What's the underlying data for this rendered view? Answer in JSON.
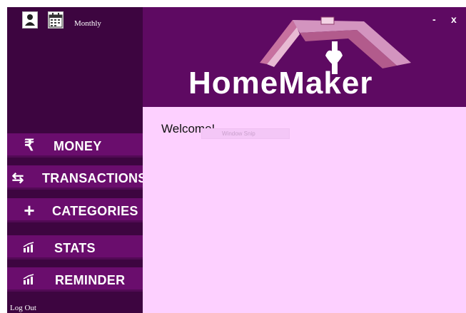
{
  "header": {
    "period": "Monthly",
    "brand": "HomeMaker",
    "minimize": "-",
    "close": "x"
  },
  "nav": [
    {
      "label": "MONEY",
      "icon": "rupee-icon",
      "glyph": "₹"
    },
    {
      "label": "TRANSACTIONS",
      "icon": "swap-arrows-icon",
      "glyph": "⇆"
    },
    {
      "label": "CATEGORIES",
      "icon": "plus-icon",
      "glyph": "+"
    },
    {
      "label": "STATS",
      "icon": "bar-chart-icon",
      "glyph": ""
    },
    {
      "label": "REMINDER",
      "icon": "bar-chart-icon",
      "glyph": ""
    }
  ],
  "footer": {
    "logout": "Log Out"
  },
  "main": {
    "welcome": "Welcome!",
    "ghost_text": "Window Snip"
  },
  "colors": {
    "sidebar": "#3d0540",
    "nav_item": "#6a0d6d",
    "header": "#5e0a62",
    "content": "#fdd0ff"
  }
}
